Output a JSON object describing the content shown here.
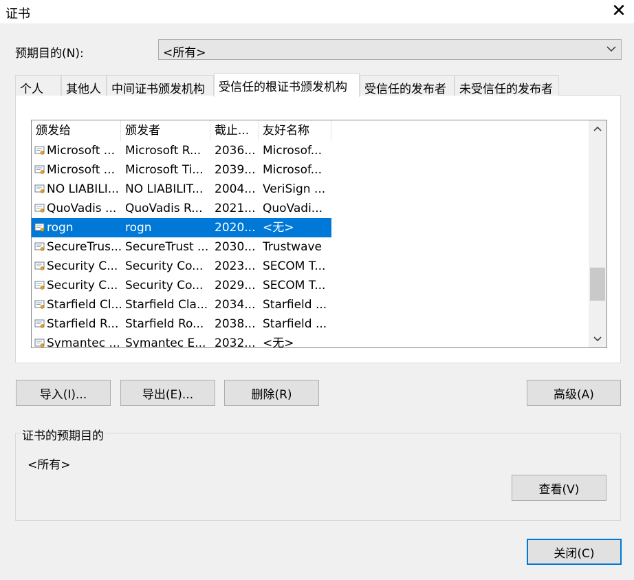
{
  "window": {
    "title": "证书",
    "close_glyph": "✕"
  },
  "purpose": {
    "label": "预期目的(N):",
    "selected": "<所有>"
  },
  "tabs": [
    {
      "label": "个人"
    },
    {
      "label": "其他人"
    },
    {
      "label": "中间证书颁发机构"
    },
    {
      "label": "受信任的根证书颁发机构"
    },
    {
      "label": "受信任的发布者"
    },
    {
      "label": "未受信任的发布者"
    }
  ],
  "active_tab": "受信任的根证书颁发机构",
  "list": {
    "columns": [
      "颁发给",
      "颁发者",
      "截止...",
      "友好名称"
    ],
    "rows": [
      [
        "Microsoft ...",
        "Microsoft R...",
        "2036...",
        "Microsof..."
      ],
      [
        "Microsoft ...",
        "Microsoft Ti...",
        "2039...",
        "Microsof..."
      ],
      [
        "NO LIABILI...",
        "NO LIABILIT...",
        "2004...",
        "VeriSign ..."
      ],
      [
        "QuoVadis ...",
        "QuoVadis R...",
        "2021...",
        "QuoVadi..."
      ],
      [
        "rogn",
        "rogn",
        "2020...",
        "<无>"
      ],
      [
        "SecureTrus...",
        "SecureTrust ...",
        "2030...",
        "Trustwave"
      ],
      [
        "Security C...",
        "Security Co...",
        "2023...",
        "SECOM T..."
      ],
      [
        "Security C...",
        "Security Co...",
        "2029...",
        "SECOM T..."
      ],
      [
        "Starfield Cl...",
        "Starfield Cla...",
        "2034...",
        "Starfield ..."
      ],
      [
        "Starfield R...",
        "Starfield Ro...",
        "2038...",
        "Starfield ..."
      ],
      [
        "Symantec ...",
        "Symantec E...",
        "2032...",
        "<无>"
      ]
    ],
    "selected_row": 4
  },
  "buttons": {
    "import": "导入(I)...",
    "export": "导出(E)...",
    "remove": "删除(R)",
    "advanced": "高级(A)",
    "view": "查看(V)",
    "close": "关闭(C)"
  },
  "intended_purposes": {
    "group_label": "证书的预期目的",
    "value": "<所有>"
  },
  "colors": {
    "selection": "#0078d7",
    "dialog_bg": "#f0f0f0"
  },
  "icons": [
    "close-icon",
    "chevron-down-icon",
    "certificate-icon",
    "scroll-up-icon",
    "scroll-down-icon"
  ]
}
